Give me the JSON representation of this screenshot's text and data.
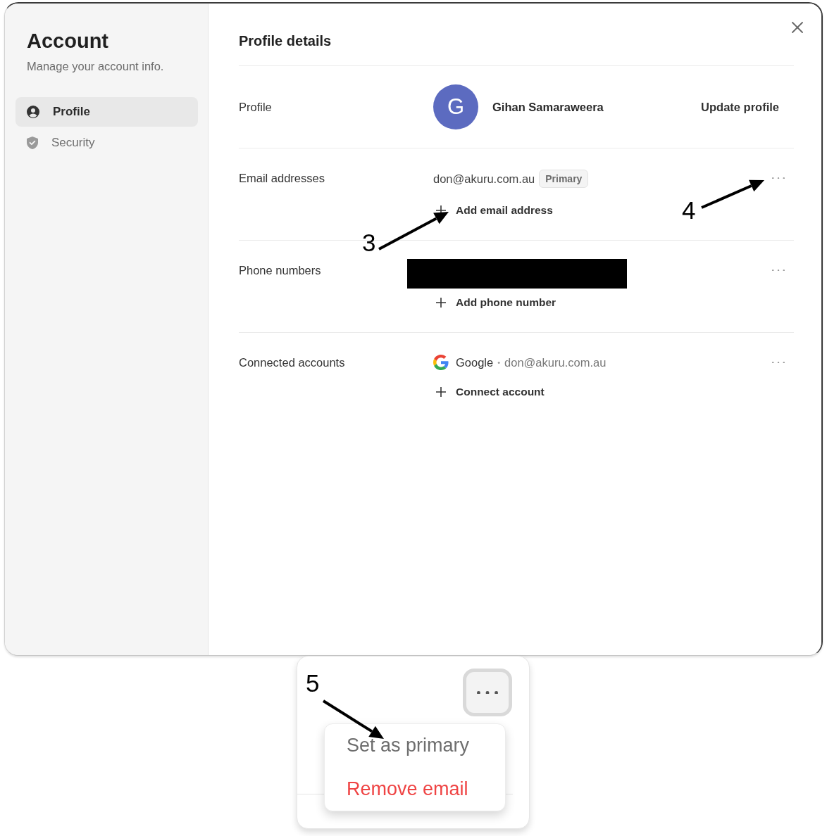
{
  "sidebar": {
    "title": "Account",
    "subtitle": "Manage your account info.",
    "items": [
      {
        "kind": "profile",
        "label": "Profile",
        "selected": true
      },
      {
        "kind": "security",
        "label": "Security",
        "selected": false
      }
    ]
  },
  "main": {
    "title": "Profile details",
    "sections": [
      {
        "kind": "profile",
        "label": "Profile",
        "avatar_initial": "G",
        "name": "Gihan Samaraweera",
        "action": "Update profile"
      },
      {
        "kind": "email",
        "label": "Email addresses",
        "emails": [
          {
            "address": "don@akuru.com.au",
            "badge": "Primary"
          }
        ],
        "add_label": "Add email address",
        "menu_button": true
      },
      {
        "kind": "phone",
        "label": "Phone numbers",
        "redacted": true,
        "add_label": "Add phone number",
        "menu_button": true
      },
      {
        "kind": "connected",
        "label": "Connected accounts",
        "accounts": [
          {
            "provider": "Google",
            "separator": "•",
            "email": "don@akuru.com.au"
          }
        ],
        "add_label": "Connect account",
        "menu_button": true
      }
    ]
  },
  "inset": {
    "menu_button_active": true,
    "menu": [
      {
        "kind": "default",
        "label": "Set as primary"
      },
      {
        "kind": "danger",
        "label": "Remove email"
      }
    ]
  },
  "annotations": [
    {
      "label": "3"
    },
    {
      "label": "4"
    },
    {
      "label": "5"
    }
  ]
}
